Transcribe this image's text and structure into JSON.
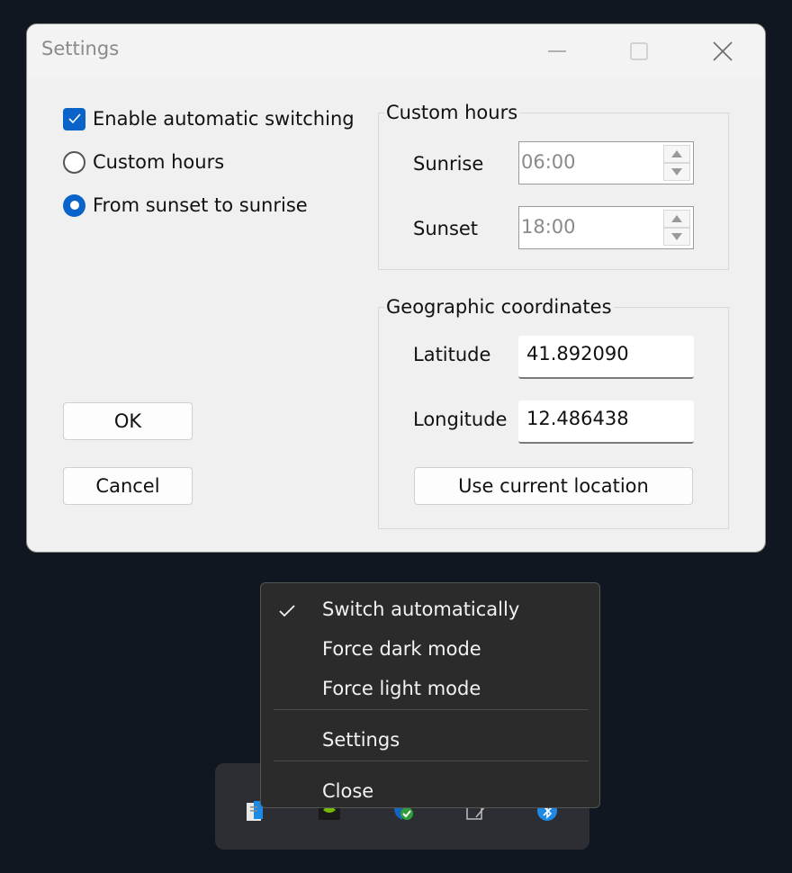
{
  "window": {
    "title": "Settings",
    "options": {
      "auto_switch_label": "Enable automatic switching",
      "auto_switch_checked": true,
      "custom_hours_label": "Custom hours",
      "custom_hours_selected": false,
      "sunset_sunrise_label": "From sunset to sunrise",
      "sunset_sunrise_selected": true
    },
    "buttons": {
      "ok": "OK",
      "cancel": "Cancel"
    },
    "custom_hours": {
      "group_label": "Custom hours",
      "sunrise_label": "Sunrise",
      "sunrise_value": "06:00",
      "sunset_label": "Sunset",
      "sunset_value": "18:00"
    },
    "geo": {
      "group_label": "Geographic coordinates",
      "latitude_label": "Latitude",
      "latitude_value": "41.892090",
      "longitude_label": "Longitude",
      "longitude_value": "12.486438",
      "use_location_label": "Use current location"
    }
  },
  "context_menu": {
    "items": [
      {
        "label": "Switch automatically",
        "checked": true
      },
      {
        "label": "Force dark mode",
        "checked": false
      },
      {
        "label": "Force light mode",
        "checked": false
      },
      {
        "label": "Settings",
        "checked": false
      },
      {
        "label": "Close",
        "checked": false
      }
    ]
  },
  "tray": {
    "icons": [
      "notepad-icon",
      "nvidia-icon",
      "security-shield-icon",
      "device-icon",
      "bluetooth-icon"
    ]
  },
  "colors": {
    "accent": "#0a63c9",
    "desktop_bg": "#111720",
    "menu_bg": "#2b2b2b"
  }
}
